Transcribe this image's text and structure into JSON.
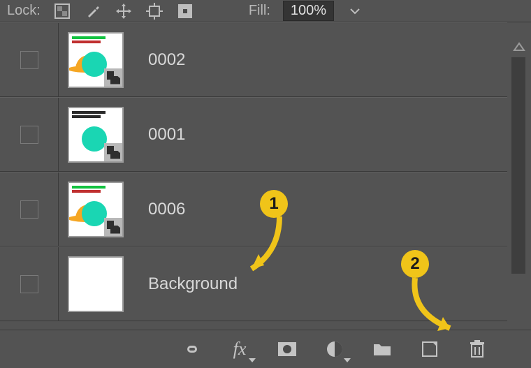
{
  "toolbar": {
    "lock_label": "Lock:",
    "fill_label": "Fill:",
    "fill_value": "100%"
  },
  "layers": [
    {
      "name": "0002",
      "thumb_kind": "hat_cd"
    },
    {
      "name": "0001",
      "thumb_kind": "text_cd"
    },
    {
      "name": "0006",
      "thumb_kind": "hat_cd"
    },
    {
      "name": "Background",
      "thumb_kind": "blank"
    }
  ],
  "annotations": {
    "step1": "1",
    "step2": "2"
  },
  "bottom": {
    "link": "link-icon",
    "fx": "fx",
    "mask": "mask-icon",
    "adjust": "adjustment-icon",
    "group": "group-icon",
    "new": "new-layer-icon",
    "trash": "trash-icon"
  }
}
